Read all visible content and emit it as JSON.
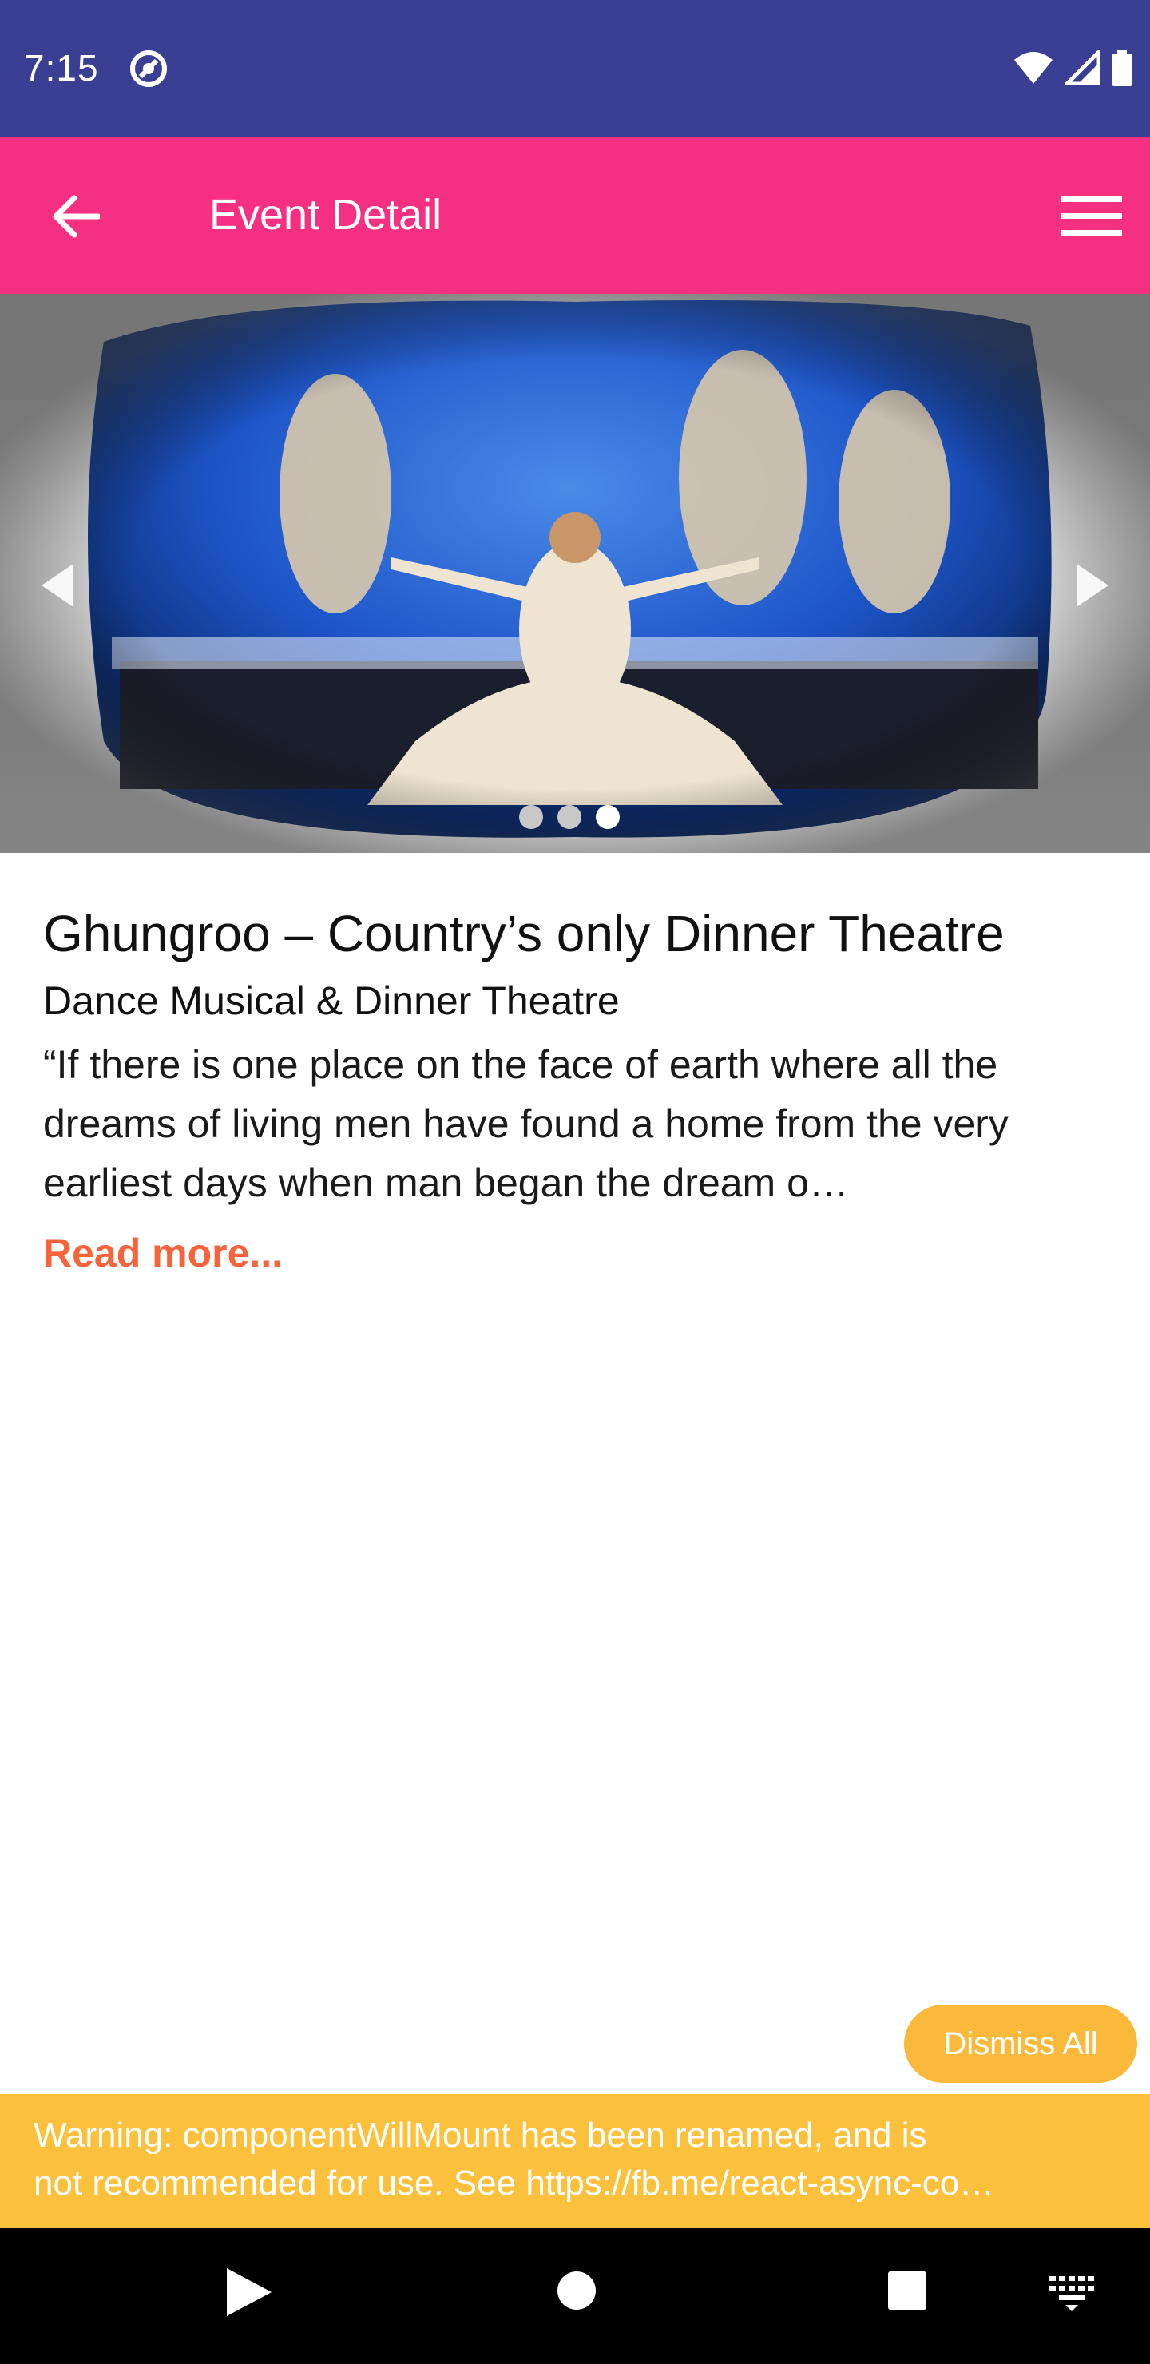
{
  "status_bar": {
    "time": "7:15",
    "icons": [
      "app-notification-icon",
      "wifi-icon",
      "signal-icon",
      "battery-icon"
    ]
  },
  "app_bar": {
    "title": "Event Detail",
    "back_icon": "arrow-left-icon",
    "menu_icon": "hamburger-menu-icon",
    "background": "#f52f82"
  },
  "carousel": {
    "slide_count": 3,
    "active_index": 2,
    "prev_icon": "triangle-left-icon",
    "next_icon": "triangle-right-icon"
  },
  "event": {
    "title": "Ghungroo – Country’s only Dinner Theatre",
    "subtitle": "Dance Musical & Dinner Theatre",
    "description": "“If there is one place on the face of earth where all the dreams of living men have found a home from the very earliest days when man began the dream o…",
    "read_more": "Read more...",
    "read_more_color": "#f7643c"
  },
  "dismiss": {
    "label": "Dismiss All",
    "color": "#fbb93b"
  },
  "warning": {
    "line1": "Warning: componentWillMount has been renamed, and is",
    "line2": "not recommended for use. See https://fb.me/react-async-co…",
    "color": "#fbc03c"
  },
  "nav_bar": {
    "icons": [
      "back-triangle-icon",
      "home-circle-icon",
      "recents-square-icon",
      "keyboard-icon"
    ]
  }
}
